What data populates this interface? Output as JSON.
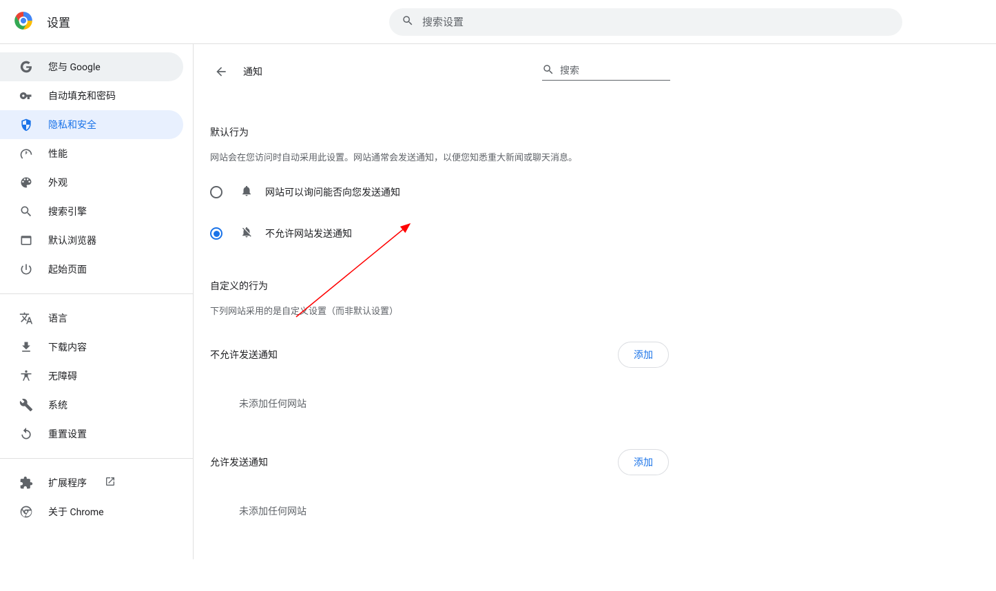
{
  "header": {
    "title": "设置",
    "search_placeholder": "搜索设置"
  },
  "sidebar": {
    "items": [
      {
        "label": "您与 Google"
      },
      {
        "label": "自动填充和密码"
      },
      {
        "label": "隐私和安全"
      },
      {
        "label": "性能"
      },
      {
        "label": "外观"
      },
      {
        "label": "搜索引擎"
      },
      {
        "label": "默认浏览器"
      },
      {
        "label": "起始页面"
      }
    ],
    "group2": [
      {
        "label": "语言"
      },
      {
        "label": "下载内容"
      },
      {
        "label": "无障碍"
      },
      {
        "label": "系统"
      },
      {
        "label": "重置设置"
      }
    ],
    "group3": [
      {
        "label": "扩展程序"
      },
      {
        "label": "关于 Chrome"
      }
    ]
  },
  "content": {
    "page_title": "通知",
    "right_search_placeholder": "搜索",
    "default_behavior": {
      "title": "默认行为",
      "desc": "网站会在您访问时自动采用此设置。网站通常会发送通知，以便您知悉重大新闻或聊天消息。",
      "options": [
        {
          "label": "网站可以询问能否向您发送通知",
          "checked": false
        },
        {
          "label": "不允许网站发送通知",
          "checked": true
        }
      ]
    },
    "custom_behavior": {
      "title": "自定义的行为",
      "desc": "下列网站采用的是自定义设置（而非默认设置）"
    },
    "blocked": {
      "title": "不允许发送通知",
      "add_btn": "添加",
      "empty": "未添加任何网站"
    },
    "allowed": {
      "title": "允许发送通知",
      "add_btn": "添加",
      "empty": "未添加任何网站"
    }
  }
}
